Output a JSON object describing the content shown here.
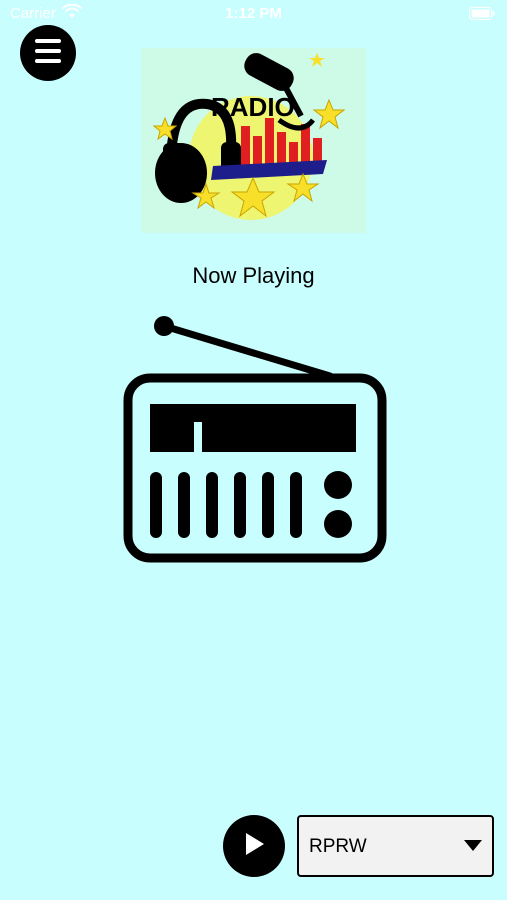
{
  "status_bar": {
    "carrier": "Carrier",
    "time": "1:12 PM"
  },
  "logo": {
    "text": "RADIO"
  },
  "now_playing": {
    "label": "Now Playing"
  },
  "player": {
    "station_selected": "RPRW"
  },
  "icons": {
    "menu": "hamburger-menu-icon",
    "radio": "radio-icon",
    "play": "play-icon",
    "dropdown": "caret-down-icon"
  },
  "colors": {
    "background": "#c8fefe",
    "accent": "#000000"
  }
}
